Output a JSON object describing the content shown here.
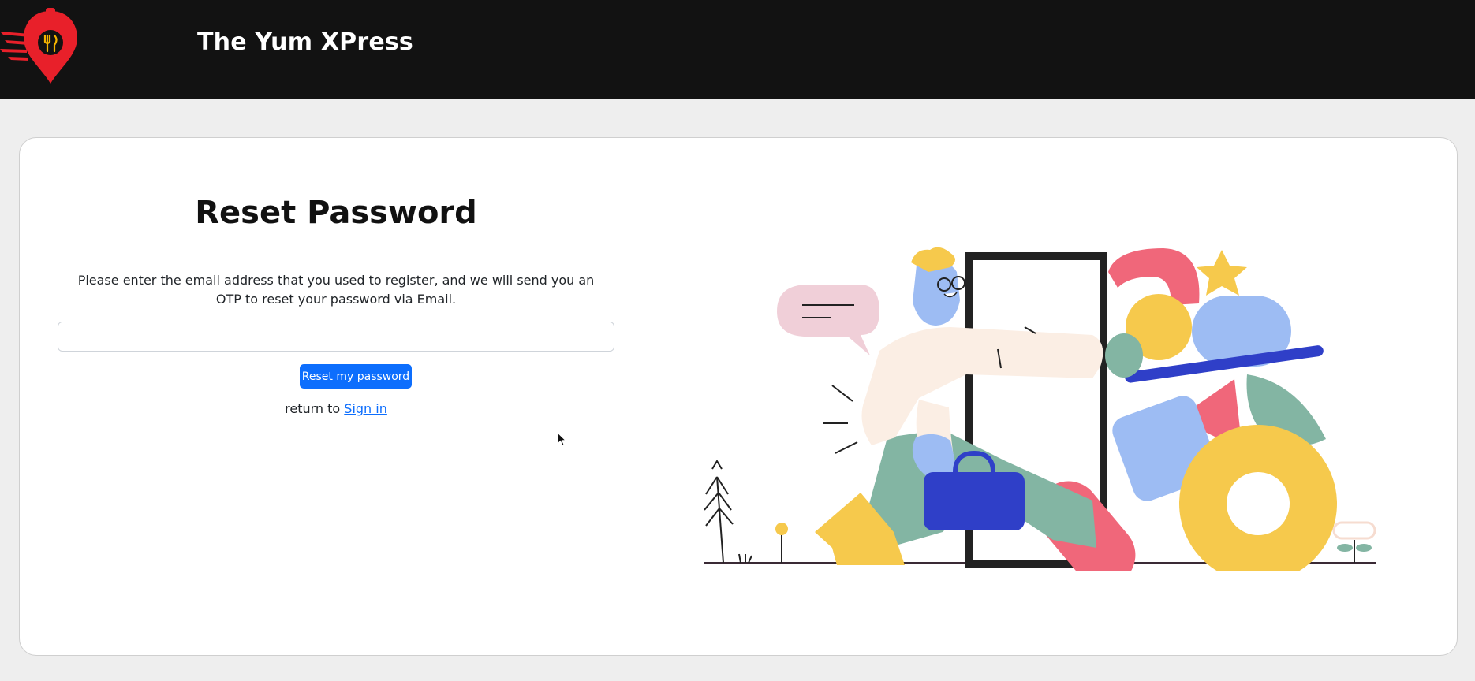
{
  "header": {
    "brand": "The Yum XPress",
    "logo_icon": "location-pin-fork-knife-icon",
    "background": "#121212",
    "logo_color": "#e8202a"
  },
  "reset_form": {
    "title": "Reset Password",
    "description": "Please enter the email address that you used to register, and we will send you an OTP to reset your password via Email.",
    "email_value": "",
    "submit_label": "Reset my password",
    "return_prefix": "return to ",
    "sign_in_label": "Sign in",
    "accent": "#0d6efd"
  },
  "illustration": {
    "icon": "person-walking-through-door-illustration"
  }
}
